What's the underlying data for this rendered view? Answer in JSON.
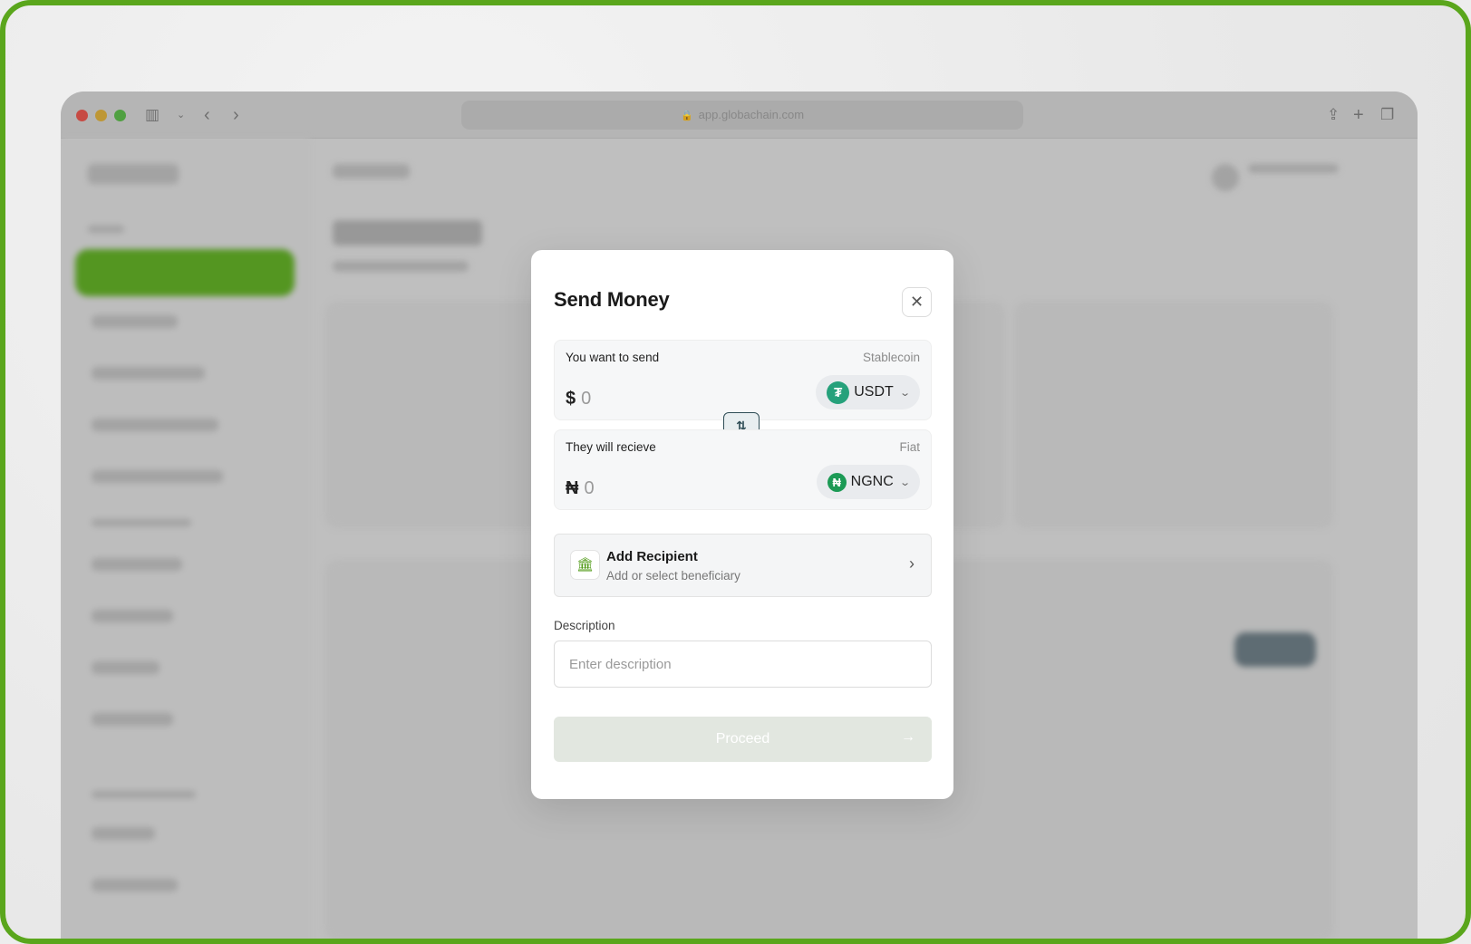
{
  "browser": {
    "url": "app.globachain.com",
    "icons": [
      "sidebar-icon",
      "chevron-down-icon",
      "back-icon",
      "forward-icon",
      "share-icon",
      "plus-icon",
      "tabs-icon"
    ]
  },
  "modal": {
    "title": "Send Money",
    "close_icon": "close-icon",
    "send": {
      "label": "You want to send",
      "kind": "Stablecoin",
      "currency_symbol": "$",
      "amount": "0",
      "token": "USDT",
      "token_icon": "tether-icon"
    },
    "swap_icon": "swap-arrows-icon",
    "receive": {
      "label": "They will recieve",
      "kind": "Fiat",
      "currency_symbol": "₦",
      "amount": "0",
      "token": "NGNC",
      "token_icon": "naira-icon"
    },
    "recipient": {
      "title": "Add Recipient",
      "subtitle": "Add or select beneficiary",
      "icon": "bank-icon"
    },
    "description": {
      "label": "Description",
      "placeholder": "Enter description",
      "value": ""
    },
    "proceed_label": "Proceed",
    "colors": {
      "brand_green": "#4f9a15",
      "tether_green": "#26a17b",
      "swap_border": "#2e4c55",
      "proceed_disabled": "#e2e7e0"
    }
  }
}
